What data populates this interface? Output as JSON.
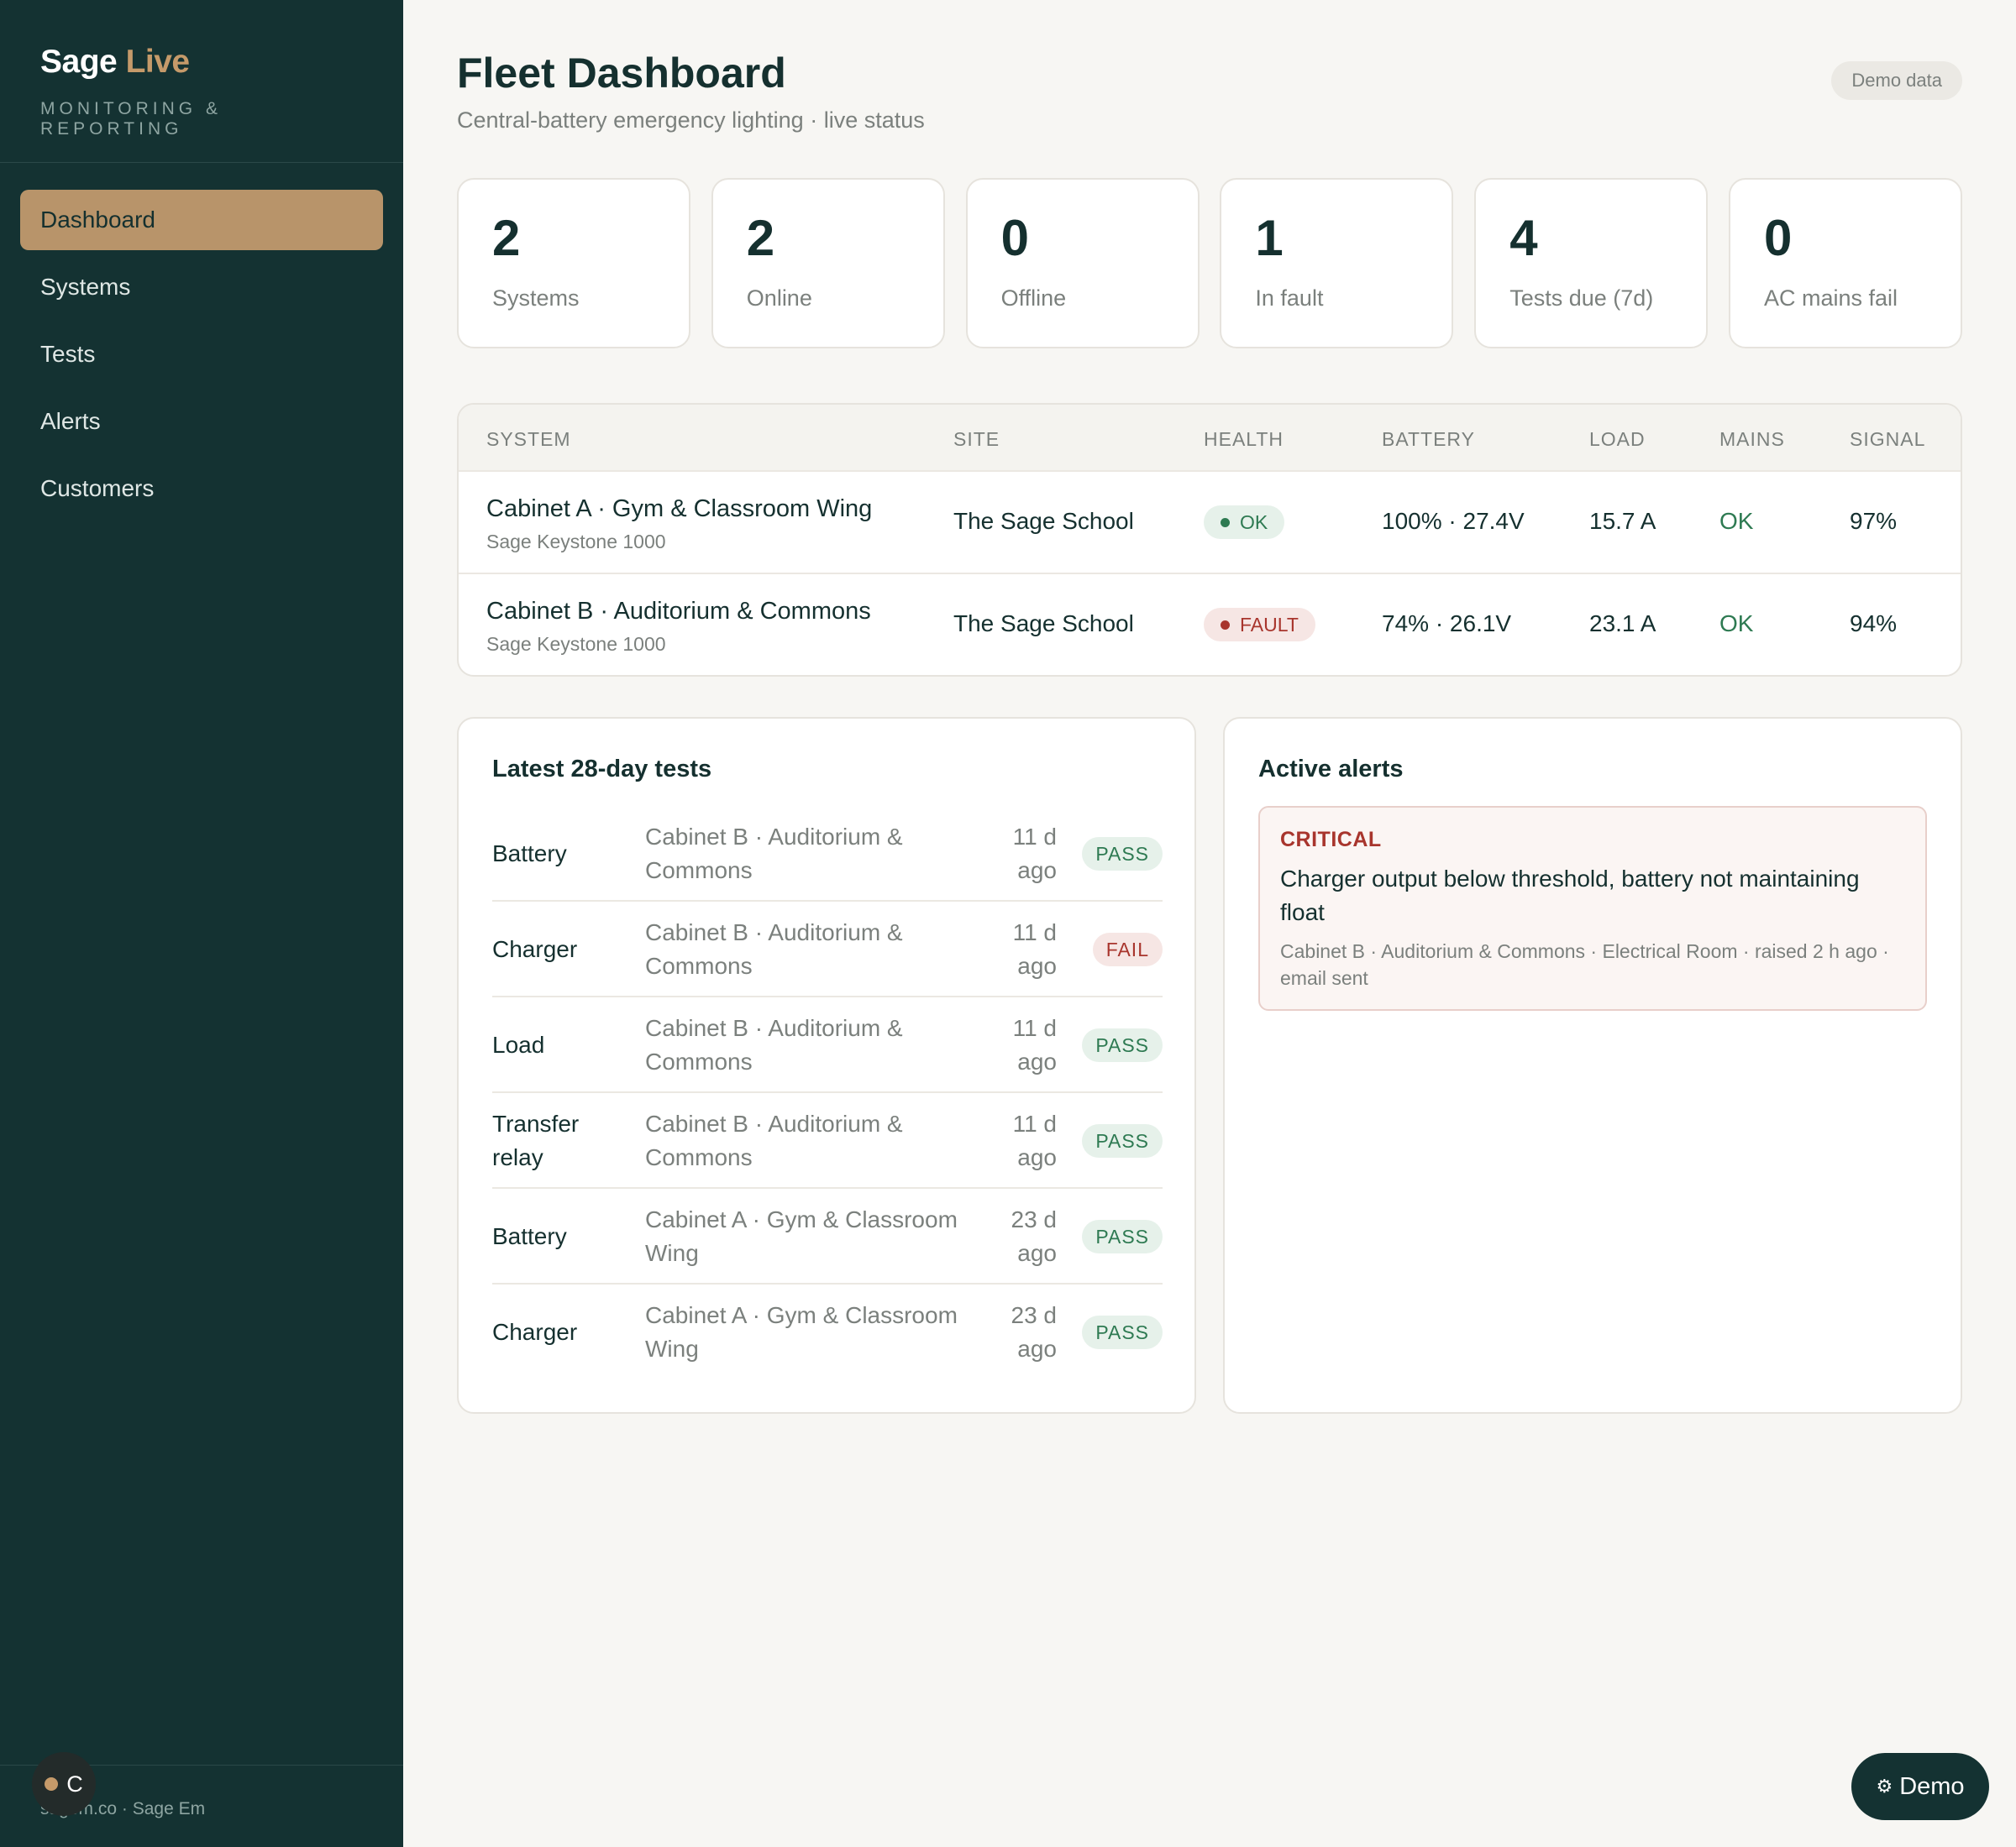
{
  "brand": {
    "name": "Sage",
    "accent": "Live",
    "subtitle": "MONITORING & REPORTING"
  },
  "nav": [
    {
      "label": "Dashboard",
      "active": true
    },
    {
      "label": "Systems"
    },
    {
      "label": "Tests"
    },
    {
      "label": "Alerts"
    },
    {
      "label": "Customers"
    }
  ],
  "footer": {
    "text": "sagem.co · Sage Em",
    "avatar_letter": "C"
  },
  "header": {
    "title": "Fleet Dashboard",
    "subtitle": "Central-battery emergency lighting · live status",
    "chip": "Demo data"
  },
  "stats": [
    {
      "value": "2",
      "label": "Systems"
    },
    {
      "value": "2",
      "label": "Online"
    },
    {
      "value": "0",
      "label": "Offline"
    },
    {
      "value": "1",
      "label": "In fault"
    },
    {
      "value": "4",
      "label": "Tests due (7d)"
    },
    {
      "value": "0",
      "label": "AC mains fail"
    }
  ],
  "table": {
    "headers": {
      "system": "SYSTEM",
      "site": "SITE",
      "health": "HEALTH",
      "battery": "BATTERY",
      "load": "LOAD",
      "mains": "MAINS",
      "signal": "SIGNAL"
    },
    "rows": [
      {
        "name": "Cabinet A · Gym & Classroom Wing",
        "model": "Sage Keystone 1000",
        "site": "The Sage School",
        "health": "OK",
        "battery": "100% · 27.4V",
        "load": "15.7 A",
        "mains": "OK",
        "signal": "97%"
      },
      {
        "name": "Cabinet B · Auditorium & Commons",
        "model": "Sage Keystone 1000",
        "site": "The Sage School",
        "health": "FAULT",
        "battery": "74% · 26.1V",
        "load": "23.1 A",
        "mains": "OK",
        "signal": "94%"
      }
    ]
  },
  "tests": {
    "title": "Latest 28-day tests",
    "items": [
      {
        "type": "Battery",
        "system": "Cabinet B · Auditorium & Commons",
        "when": "11 d ago",
        "result": "PASS"
      },
      {
        "type": "Charger",
        "system": "Cabinet B · Auditorium & Commons",
        "when": "11 d ago",
        "result": "FAIL"
      },
      {
        "type": "Load",
        "system": "Cabinet B · Auditorium & Commons",
        "when": "11 d ago",
        "result": "PASS"
      },
      {
        "type": "Transfer relay",
        "system": "Cabinet B · Auditorium & Commons",
        "when": "11 d ago",
        "result": "PASS"
      },
      {
        "type": "Battery",
        "system": "Cabinet A · Gym & Classroom Wing",
        "when": "23 d ago",
        "result": "PASS"
      },
      {
        "type": "Charger",
        "system": "Cabinet A · Gym & Classroom Wing",
        "when": "23 d ago",
        "result": "PASS"
      }
    ]
  },
  "alerts": {
    "title": "Active alerts",
    "items": [
      {
        "severity": "CRITICAL",
        "message": "Charger output below threshold, battery not maintaining float",
        "meta": "Cabinet B · Auditorium & Commons · Electrical Room · raised 2 h ago · email sent"
      }
    ]
  },
  "demo_button": {
    "icon": "gear-icon",
    "label": "Demo"
  },
  "colors": {
    "sidebar": "#143232",
    "accent": "#b8946a",
    "ok": "#2e7a52",
    "fault": "#a8352d",
    "background": "#f7f6f3"
  }
}
